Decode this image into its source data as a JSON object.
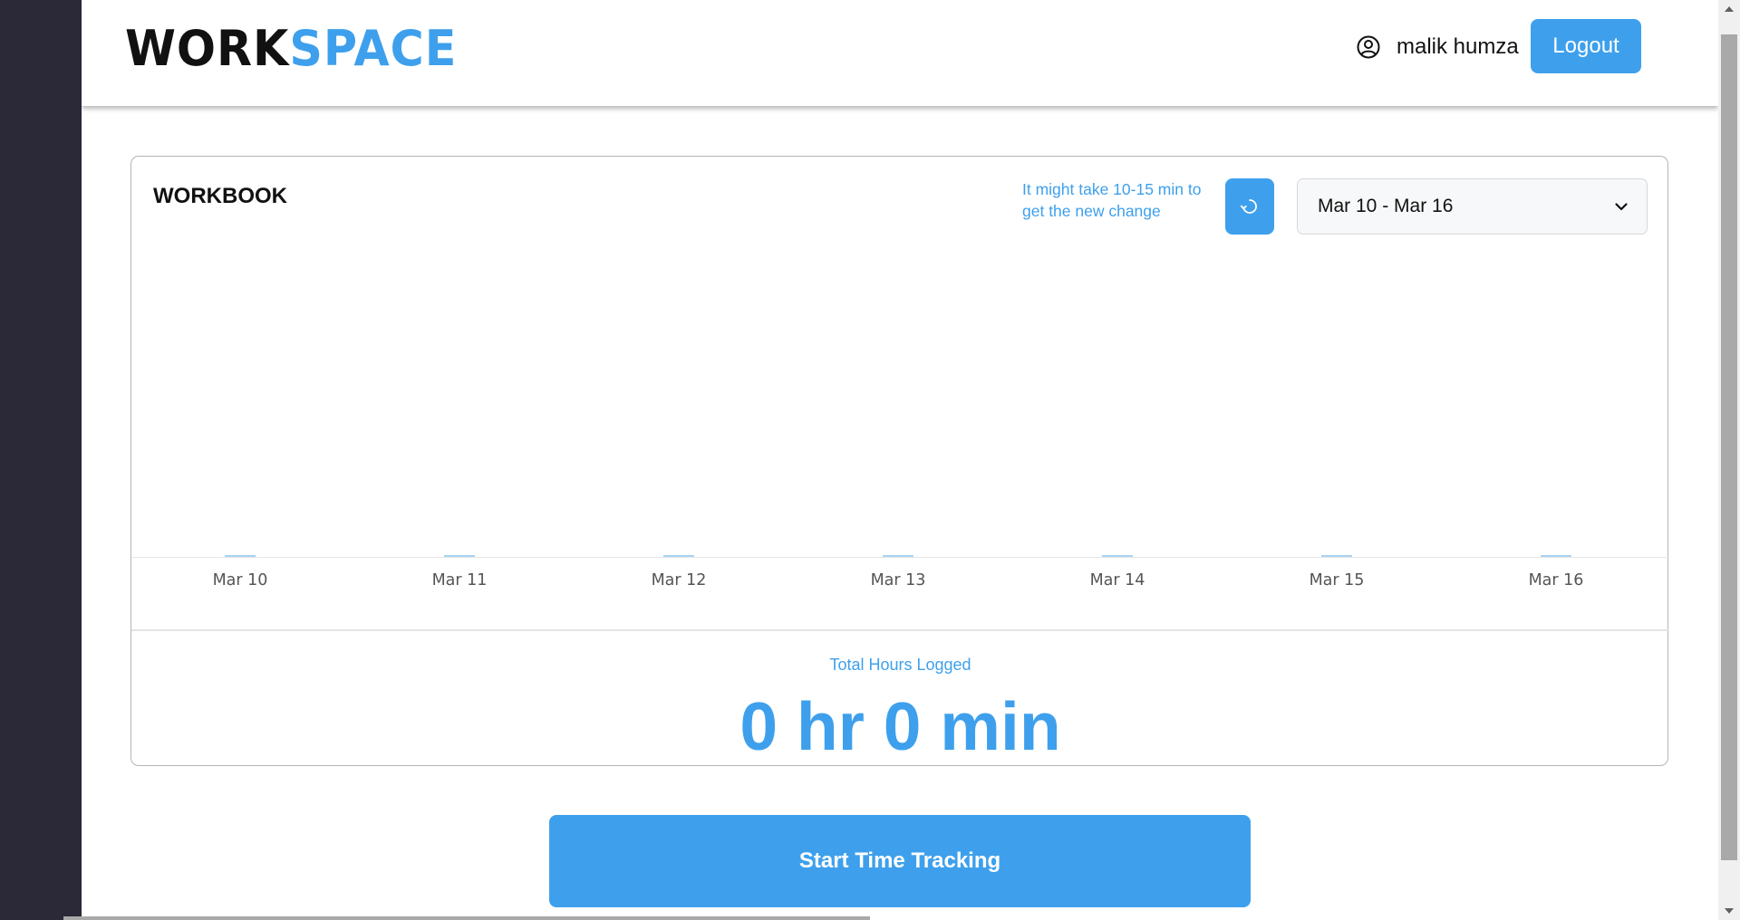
{
  "header": {
    "logo_dark": "WORK",
    "logo_accent": "SPACE",
    "user_name": "malik humza",
    "logout_label": "Logout"
  },
  "workbook": {
    "title": "WORKBOOK",
    "note": "It might take 10-15 min to get the new change",
    "date_range": "Mar 10 - Mar 16"
  },
  "chart_data": {
    "type": "bar",
    "categories": [
      "Mar 10",
      "Mar 11",
      "Mar 12",
      "Mar 13",
      "Mar 14",
      "Mar 15",
      "Mar 16"
    ],
    "values": [
      0,
      0,
      0,
      0,
      0,
      0,
      0
    ],
    "title": "",
    "xlabel": "",
    "ylabel": "",
    "grid": false,
    "bar_color": "#a8d3f3"
  },
  "totals": {
    "label": "Total Hours Logged",
    "value": "0 hr 0 min"
  },
  "actions": {
    "start_label": "Start Time Tracking"
  },
  "colors": {
    "accent": "#3ea0ec",
    "sidebar": "#2b2838"
  },
  "icons": {
    "user": "user-circle-icon",
    "refresh": "refresh-icon",
    "select": "chevron-down-icon"
  }
}
